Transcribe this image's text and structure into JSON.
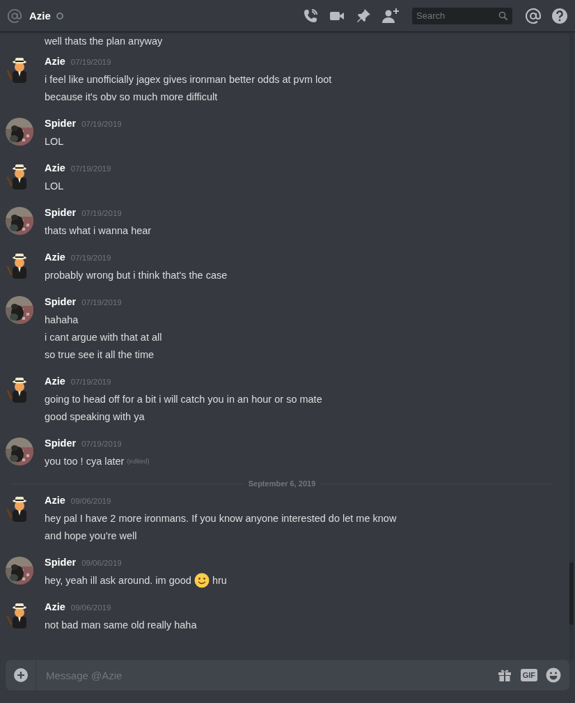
{
  "header": {
    "channel": "Azie",
    "search_placeholder": "Search"
  },
  "messages": [
    {
      "kind": "continuation",
      "lines": [
        {
          "text": "well thats the plan anyway"
        }
      ]
    },
    {
      "kind": "message",
      "avatar": {
        "kind": "drawing"
      },
      "author": "Azie",
      "timestamp": "07/19/2019",
      "lines": [
        {
          "text": "i feel like unofficially jagex gives ironman better odds at pvm loot"
        },
        {
          "text": "because it's obv so much more difficult"
        }
      ]
    },
    {
      "kind": "message",
      "avatar": {
        "kind": "picture"
      },
      "author": "Spider",
      "timestamp": "07/19/2019",
      "lines": [
        {
          "text": "LOL"
        }
      ]
    },
    {
      "kind": "message",
      "avatar": {
        "kind": "drawing"
      },
      "author": "Azie",
      "timestamp": "07/19/2019",
      "lines": [
        {
          "text": "LOL"
        }
      ]
    },
    {
      "kind": "message",
      "avatar": {
        "kind": "picture"
      },
      "author": "Spider",
      "timestamp": "07/19/2019",
      "lines": [
        {
          "text": "thats what i wanna hear"
        }
      ]
    },
    {
      "kind": "message",
      "avatar": {
        "kind": "drawing"
      },
      "author": "Azie",
      "timestamp": "07/19/2019",
      "lines": [
        {
          "text": "probably wrong but i think that's the case"
        }
      ]
    },
    {
      "kind": "message",
      "avatar": {
        "kind": "picture"
      },
      "author": "Spider",
      "timestamp": "07/19/2019",
      "lines": [
        {
          "text": "hahaha"
        },
        {
          "text": "i cant argue with that at all"
        },
        {
          "text": "so true see it all the time"
        }
      ]
    },
    {
      "kind": "message",
      "avatar": {
        "kind": "drawing"
      },
      "author": "Azie",
      "timestamp": "07/19/2019",
      "lines": [
        {
          "text": "going to head off for a bit i will catch you in an hour or so mate"
        },
        {
          "text": "good speaking with ya"
        }
      ]
    },
    {
      "kind": "message",
      "avatar": {
        "kind": "picture"
      },
      "author": "Spider",
      "timestamp": "07/19/2019",
      "lines": [
        {
          "text": "you too ! cya later",
          "edited": "(edited)"
        }
      ]
    },
    {
      "kind": "divider",
      "label": "September 6, 2019"
    },
    {
      "kind": "message",
      "avatar": {
        "kind": "drawing"
      },
      "author": "Azie",
      "timestamp": "09/06/2019",
      "lines": [
        {
          "text": "hey pal I have 2 more ironmans. If you know anyone interested do let me know"
        },
        {
          "text": "and hope you're well"
        }
      ]
    },
    {
      "kind": "message",
      "avatar": {
        "kind": "picture"
      },
      "author": "Spider",
      "timestamp": "09/06/2019",
      "lines": [
        {
          "text": "hey, yeah ill ask around. im good",
          "emoji": true,
          "after": "hru"
        }
      ]
    },
    {
      "kind": "message",
      "avatar": {
        "kind": "drawing"
      },
      "author": "Azie",
      "timestamp": "09/06/2019",
      "lines": [
        {
          "text": "not bad man same old really haha"
        }
      ]
    }
  ],
  "composer": {
    "placeholder": "Message @Azie",
    "gif_label": "GIF"
  }
}
